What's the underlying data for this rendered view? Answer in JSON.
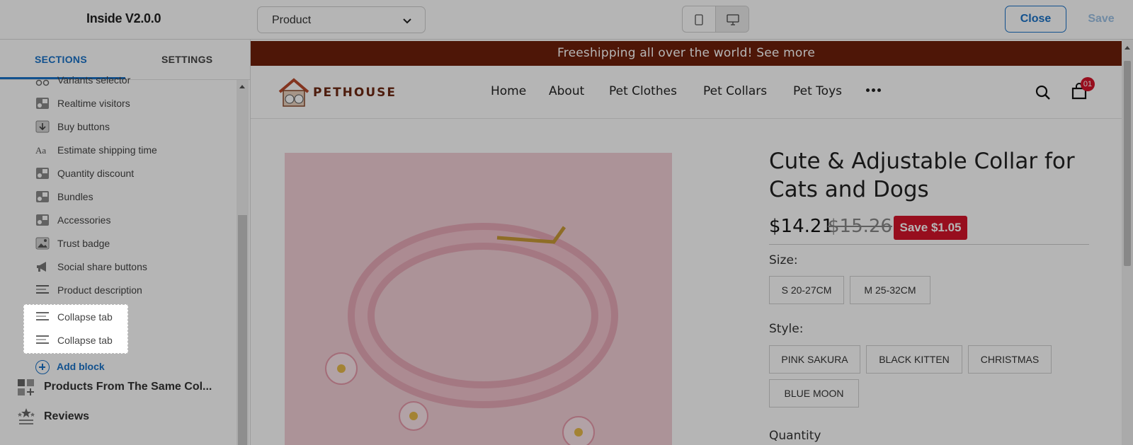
{
  "app": {
    "title": "Inside V2.0.0"
  },
  "page_select": {
    "value": "Product"
  },
  "device": {
    "mobile_icon": "mobile-icon",
    "desktop_icon": "desktop-icon",
    "active": "desktop"
  },
  "actions": {
    "close_label": "Close",
    "save_label": "Save"
  },
  "sidebar": {
    "tabs": [
      {
        "label": "SECTIONS",
        "active": true
      },
      {
        "label": "SETTINGS",
        "active": false
      }
    ],
    "blocks": [
      {
        "label": "Variants selector",
        "icon": "variants-icon"
      },
      {
        "label": "Realtime visitors",
        "icon": "app-block-icon"
      },
      {
        "label": "Buy buttons",
        "icon": "buy-buttons-icon"
      },
      {
        "label": "Estimate shipping time",
        "icon": "text-icon"
      },
      {
        "label": "Quantity discount",
        "icon": "app-block-icon"
      },
      {
        "label": "Bundles",
        "icon": "app-block-icon"
      },
      {
        "label": "Accessories",
        "icon": "app-block-icon"
      },
      {
        "label": "Trust badge",
        "icon": "image-icon"
      },
      {
        "label": "Social share buttons",
        "icon": "megaphone-icon"
      },
      {
        "label": "Product description",
        "icon": "paragraph-icon"
      },
      {
        "label": "Collapse tab",
        "icon": "paragraph-icon"
      },
      {
        "label": "Collapse tab",
        "icon": "paragraph-icon"
      }
    ],
    "add_block_label": "Add block",
    "sections": [
      {
        "label": "Products From The Same Col...",
        "icon": "grid-add-icon"
      },
      {
        "label": "Reviews",
        "icon": "stars-icon"
      }
    ]
  },
  "store": {
    "announcement": "Freeshipping all over the world! See more",
    "logo_text": "PETHOUSE",
    "nav": [
      "Home",
      "About",
      "Pet Clothes",
      "Pet Collars",
      "Pet Toys"
    ],
    "cart_count": "01"
  },
  "product": {
    "title": "Cute & Adjustable Collar for Cats and Dogs",
    "price": "$14.21",
    "compare_price": "$15.26",
    "save_label": "Save $1.05",
    "size_label": "Size:",
    "sizes": [
      "S 20-27CM",
      "M 25-32CM"
    ],
    "style_label": "Style:",
    "styles": [
      "PINK SAKURA",
      "BLACK KITTEN",
      "CHRISTMAS",
      "BLUE MOON"
    ],
    "quantity_label": "Quantity"
  },
  "colors": {
    "accent": "#1a73c8",
    "announcement_bg": "#6e200a",
    "sale_badge": "#d5142b"
  }
}
